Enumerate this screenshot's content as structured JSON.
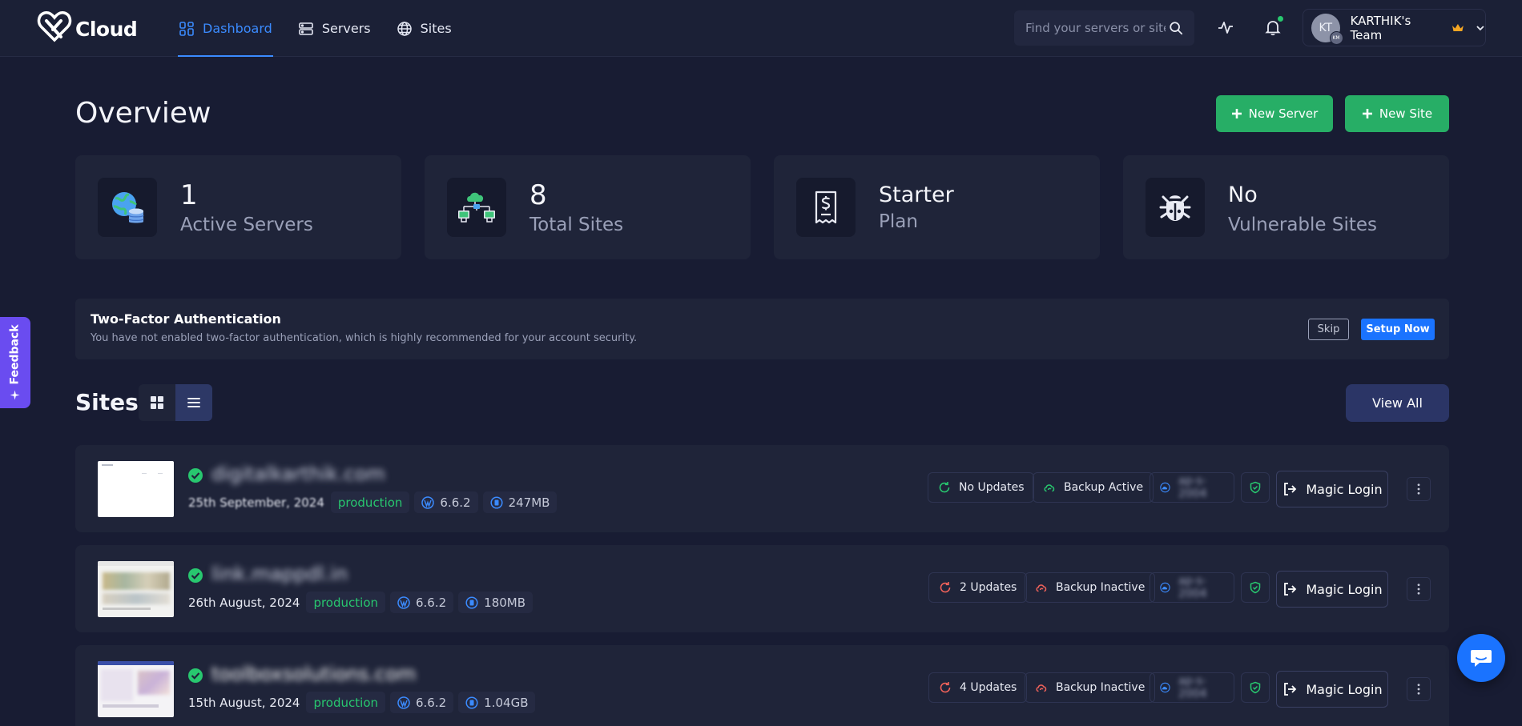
{
  "app": {
    "logo_text": "Cloud",
    "nav": [
      {
        "label": "Dashboard",
        "icon": "dashboard-grid-icon",
        "active": true
      },
      {
        "label": "Servers",
        "icon": "server-icon",
        "active": false
      },
      {
        "label": "Sites",
        "icon": "globe-icon",
        "active": false
      }
    ],
    "search_placeholder": "Find your servers or sites",
    "team": {
      "initials": "KT",
      "sub_initials": "KM",
      "name": "KARTHIK's Team"
    }
  },
  "overview": {
    "title": "Overview",
    "new_server_label": "New Server",
    "new_site_label": "New Site",
    "stats": [
      {
        "value": "1",
        "label": "Active Servers",
        "icon": "globe-database-icon"
      },
      {
        "value": "8",
        "label": "Total Sites",
        "icon": "cloud-network-icon"
      },
      {
        "value": "Starter",
        "label": "Plan",
        "icon": "receipt-dollar-icon"
      },
      {
        "value": "No",
        "label": "Vulnerable Sites",
        "icon": "bug-icon"
      }
    ]
  },
  "two_factor": {
    "title": "Two-Factor Authentication",
    "description": "You have not enabled two-factor authentication, which is highly recommended for your account security.",
    "skip_label": "Skip",
    "setup_label": "Setup Now"
  },
  "sites": {
    "title": "Sites",
    "view_all_label": "View All",
    "magic_login_label": "Magic Login",
    "rows": [
      {
        "name": "digitalkarthik.com",
        "date": "25th September, 2024",
        "environment": "production",
        "wp_version": "6.6.2",
        "size": "247MB",
        "updates": "No Updates",
        "updates_status": "ok",
        "backup": "Backup Active",
        "backup_status": "ok",
        "cdn": "ap-s-2004"
      },
      {
        "name": "link.mappdl.in",
        "date": "26th August, 2024",
        "environment": "production",
        "wp_version": "6.6.2",
        "size": "180MB",
        "updates": "2 Updates",
        "updates_status": "warn",
        "backup": "Backup Inactive",
        "backup_status": "warn",
        "cdn": "ap-s-2004"
      },
      {
        "name": "toolboxsolutions.com",
        "date": "15th August, 2024",
        "environment": "production",
        "wp_version": "6.6.2",
        "size": "1.04GB",
        "updates": "4 Updates",
        "updates_status": "warn",
        "backup": "Backup Inactive",
        "backup_status": "warn",
        "cdn": "ap-s-2004"
      }
    ]
  },
  "feedback_label": "Feedback",
  "colors": {
    "background": "#181c33",
    "card": "#1f2439",
    "accent_blue": "#3b8bff",
    "green": "#27ae66",
    "warning_red": "#f0625a"
  }
}
